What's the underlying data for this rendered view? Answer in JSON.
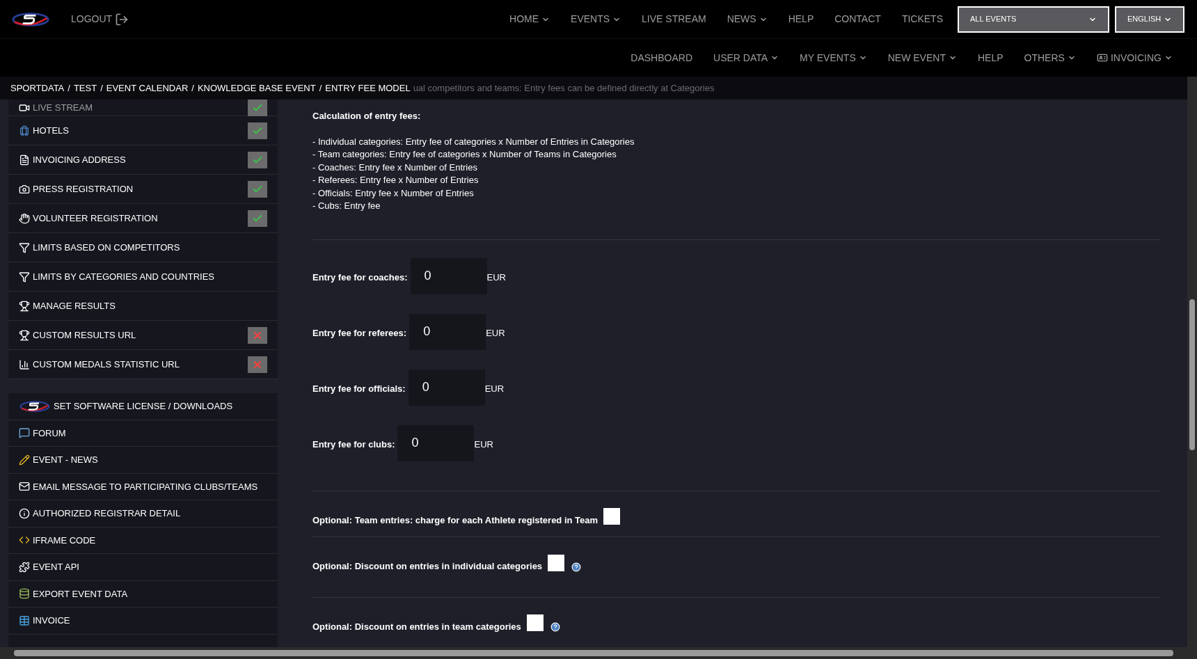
{
  "top_nav": {
    "logout": "LOGOUT",
    "items": [
      {
        "label": "HOME",
        "dropdown": true
      },
      {
        "label": "EVENTS",
        "dropdown": true
      },
      {
        "label": "LIVE STREAM",
        "dropdown": false
      },
      {
        "label": "NEWS",
        "dropdown": true
      },
      {
        "label": "HELP",
        "dropdown": false
      },
      {
        "label": "CONTACT",
        "dropdown": false
      },
      {
        "label": "TICKETS",
        "dropdown": false
      }
    ],
    "event_select": "ALL EVENTS",
    "language_select": "ENGLISH"
  },
  "sub_nav": [
    {
      "label": "DASHBOARD",
      "dropdown": false
    },
    {
      "label": "USER DATA",
      "dropdown": true
    },
    {
      "label": "MY EVENTS",
      "dropdown": true
    },
    {
      "label": "NEW EVENT",
      "dropdown": true
    },
    {
      "label": "HELP",
      "dropdown": false
    },
    {
      "label": "OTHERS",
      "dropdown": true
    },
    {
      "label": "INVOICING",
      "dropdown": true
    }
  ],
  "breadcrumb_separator": "/",
  "breadcrumb": [
    "SPORTDATA",
    "TEST",
    "EVENT CALENDAR",
    "KNOWLEDGE BASE EVENT",
    "ENTRY FEE MODEL"
  ],
  "notice": "ual competitors and teams: Entry fees can be defined directly at Categories",
  "sidebar": {
    "group_1": [
      {
        "label": "LIVE STREAM",
        "done": true
      },
      {
        "label": "HOTELS",
        "done": true
      },
      {
        "label": "INVOICING ADDRESS",
        "done": true
      },
      {
        "label": "PRESS REGISTRATION",
        "done": true
      },
      {
        "label": "VOLUNTEER REGISTRATION",
        "done": true
      },
      {
        "label": "LIMITS BASED ON COMPETITORS"
      },
      {
        "label": "LIMITS BY CATEGORIES AND COUNTRIES"
      },
      {
        "label": "MANAGE RESULTS"
      },
      {
        "label": "CUSTOM RESULTS URL",
        "done": false
      },
      {
        "label": "CUSTOM MEDALS STATISTIC URL",
        "done": false
      }
    ],
    "group_2": [
      {
        "label": "SET SOFTWARE LICENSE / DOWNLOADS"
      },
      {
        "label": "FORUM"
      },
      {
        "label": "EVENT - NEWS"
      },
      {
        "label": "EMAIL MESSAGE TO PARTICIPATING CLUBS/TEAMS"
      },
      {
        "label": "AUTHORIZED REGISTRAR DETAIL"
      },
      {
        "label": "IFRAME CODE"
      },
      {
        "label": "EVENT API"
      },
      {
        "label": "EXPORT EVENT DATA"
      },
      {
        "label": "INVOICE"
      }
    ]
  },
  "calculation": {
    "title": "Calculation of entry fees:",
    "lines": [
      "- Individual categories: Entry fee of categories x Number of Entries in Categories",
      "- Team categories: Entry fee of categories x Number of Teams in Categories",
      "- Coaches: Entry fee x Number of Entries",
      "- Referees: Entry fee x Number of Entries",
      "- Officials: Entry fee x Number of Entries",
      "- Cubs: Entry fee"
    ]
  },
  "fees": [
    {
      "label": "Entry fee for coaches:",
      "value": "0",
      "unit": "EUR"
    },
    {
      "label": "Entry fee for referees:",
      "value": "0",
      "unit": "EUR"
    },
    {
      "label": "Entry fee for officials:",
      "value": "0",
      "unit": "EUR"
    },
    {
      "label": "Entry fee for clubs:",
      "value": "0",
      "unit": "EUR"
    }
  ],
  "options": [
    {
      "label": "Optional: Team entries: charge for each Athlete registered in Team",
      "checked": false,
      "help": false
    },
    {
      "label": "Optional: Discount on entries in individual categories",
      "checked": false,
      "help": true
    },
    {
      "label": "Optional: Discount on entries in team categories",
      "checked": false,
      "help": true
    }
  ]
}
